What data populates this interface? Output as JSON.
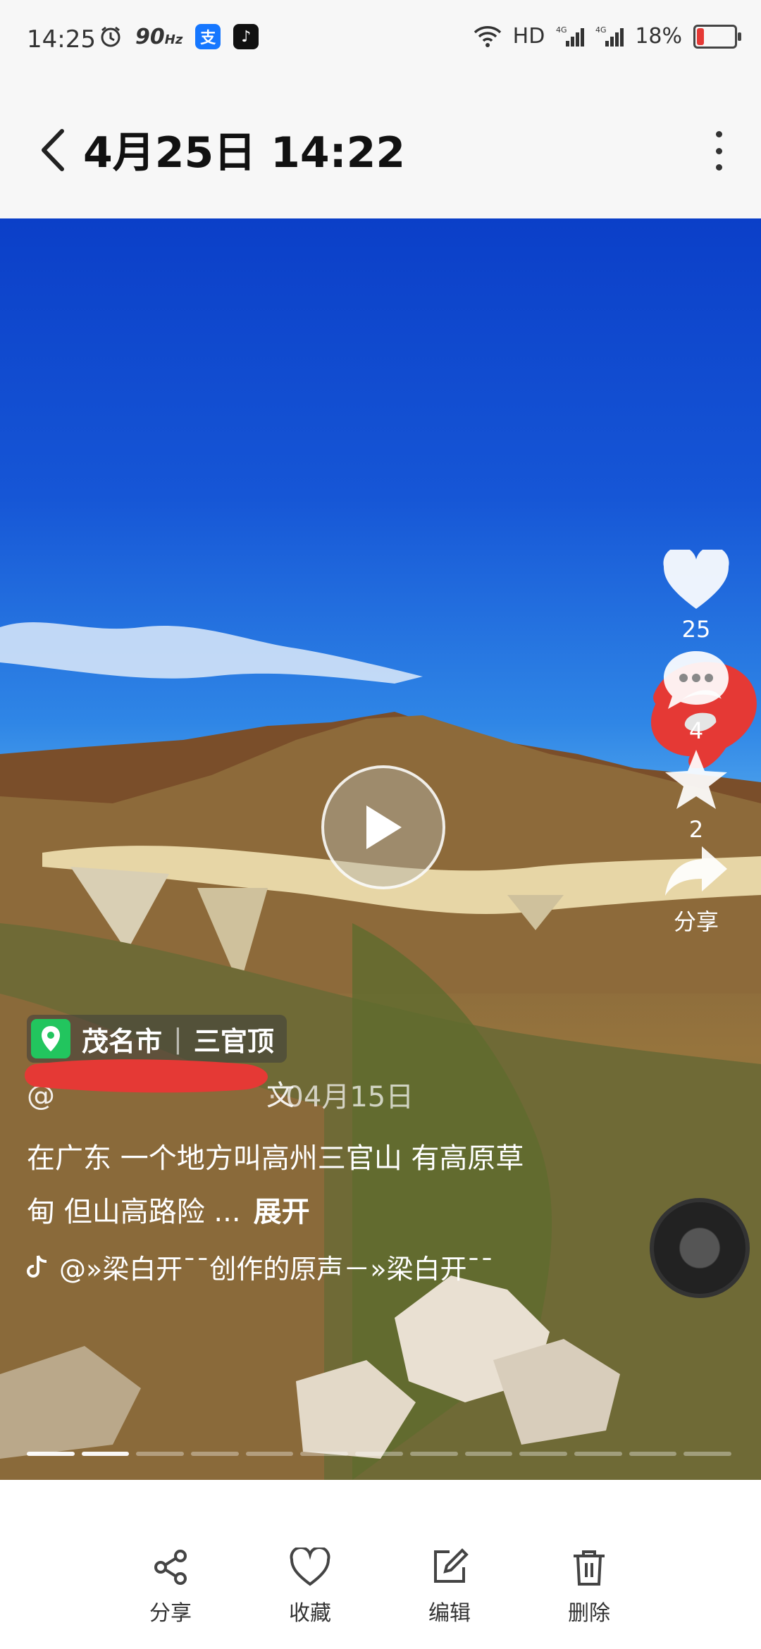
{
  "status_bar": {
    "time": "14:25",
    "refresh": "90",
    "refresh_unit": "Hz",
    "network": "HD",
    "battery": "18%",
    "battery_level": 0.18,
    "icons": [
      "alarm-icon",
      "alipay-icon",
      "tiktok-icon",
      "wifi-icon",
      "signal-icon",
      "battery-icon"
    ]
  },
  "header": {
    "title": "4月25日 14:22"
  },
  "video": {
    "location_city": "茂名市",
    "location_place": "三官顶",
    "author_prefix": "@",
    "author_suffix": "文",
    "date": "· 04月15日",
    "description": "在广东 一个地方叫高州三官山 有高原草甸 但山高路险 ...",
    "expand_label": "展开",
    "music": "@»梁白开¯¯创作的原声－»梁白开¯¯",
    "likes": "25",
    "comments": "4",
    "favorites": "2",
    "share": "分享",
    "progress_segments": 13,
    "progress_active": 2
  },
  "toolbar": {
    "share": "分享",
    "favorite": "收藏",
    "edit": "编辑",
    "delete": "删除"
  }
}
